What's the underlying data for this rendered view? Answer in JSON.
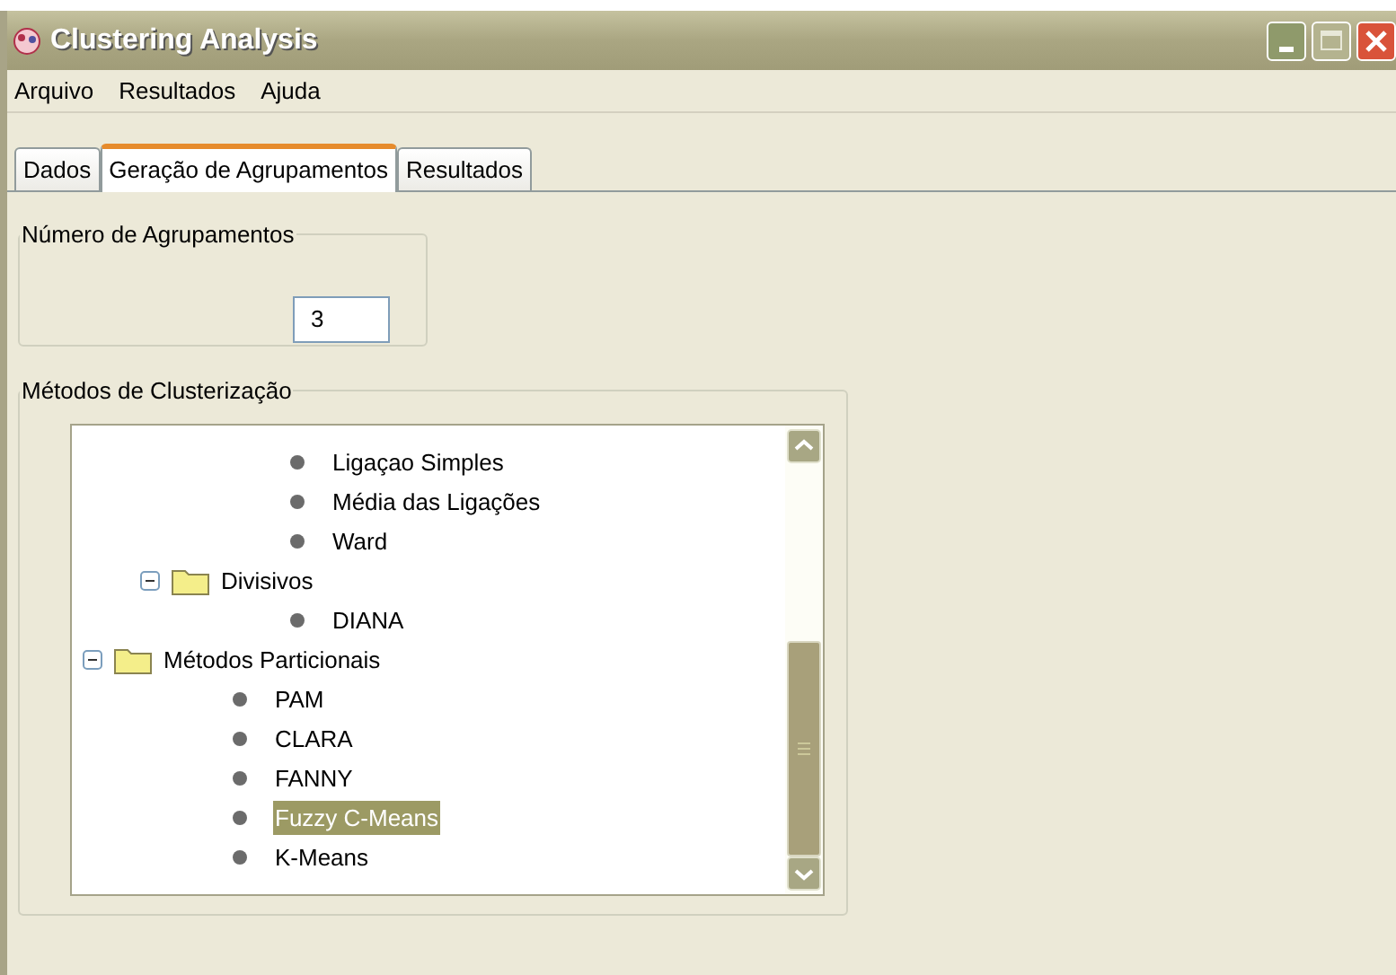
{
  "window": {
    "title": "Clustering Analysis"
  },
  "menu": [
    "Arquivo",
    "Resultados",
    "Ajuda"
  ],
  "tabs": [
    {
      "label": "Dados",
      "selected": false
    },
    {
      "label": "Geração de Agrupamentos",
      "selected": true
    },
    {
      "label": "Resultados",
      "selected": false
    }
  ],
  "clusters_group": {
    "title": "Número de Agrupamentos",
    "value": "3"
  },
  "methods_group": {
    "title": "Métodos de Clusterização",
    "tree": [
      {
        "children": [
          {
            "children": [
              {
                "label": "Ligaçao Simples",
                "selected": false
              },
              {
                "label": "Média das Ligações",
                "selected": false
              },
              {
                "label": "Ward",
                "selected": false
              }
            ]
          },
          {
            "label": "Divisivos",
            "expanded": true,
            "children": [
              {
                "label": "DIANA",
                "selected": false
              }
            ]
          }
        ]
      },
      {
        "label": "Métodos Particionais",
        "expanded": true,
        "children": [
          {
            "label": "PAM",
            "selected": false
          },
          {
            "label": "CLARA",
            "selected": false
          },
          {
            "label": "FANNY",
            "selected": false
          },
          {
            "label": "Fuzzy C-Means",
            "selected": true
          },
          {
            "label": "K-Means",
            "selected": false
          }
        ]
      }
    ]
  }
}
